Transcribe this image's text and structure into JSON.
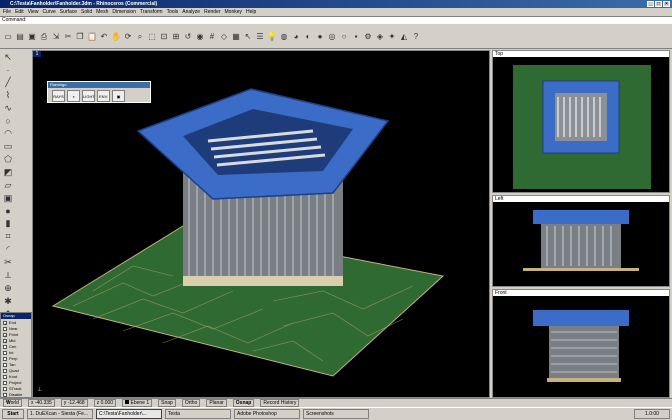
{
  "window": {
    "title": "C:\\Testa\\Fanholder\\Fanholder.3dm - Rhinoceros (Commercial)"
  },
  "menu": [
    "File",
    "Edit",
    "View",
    "Curve",
    "Surface",
    "Solid",
    "Mesh",
    "Dimension",
    "Transform",
    "Tools",
    "Analyze",
    "Render",
    "Monkey",
    "Help"
  ],
  "command": {
    "label": "Command"
  },
  "palette": {
    "title": "Flamingo",
    "buttons": [
      "RAYS RENDER",
      "",
      "LIGHT SET",
      "ENV. RUN",
      ""
    ]
  },
  "viewports": {
    "main_tag": "1",
    "top": "Top",
    "left": "Left",
    "front": "Front"
  },
  "osnap": {
    "title": "Osnap",
    "items": [
      {
        "label": "End",
        "on": true
      },
      {
        "label": "Near",
        "on": false
      },
      {
        "label": "Point",
        "on": true
      },
      {
        "label": "Mid",
        "on": true
      },
      {
        "label": "Cen",
        "on": false
      },
      {
        "label": "Int",
        "on": false
      },
      {
        "label": "Perp",
        "on": false
      },
      {
        "label": "Tan",
        "on": false
      },
      {
        "label": "Quad",
        "on": false
      },
      {
        "label": "Knot",
        "on": false
      },
      {
        "label": "Project",
        "on": false
      },
      {
        "label": "STrack",
        "on": false
      },
      {
        "label": "Disable",
        "on": false
      }
    ]
  },
  "status": {
    "cplane": "World",
    "x": "x -40.335",
    "y": "y -12.468",
    "z": "z 0.000",
    "layer": "Ebene 1",
    "snap": "Snap",
    "ortho": "Ortho",
    "planar": "Planar",
    "osnap": "Osnap",
    "record": "Record History"
  },
  "taskbar": {
    "start": "Start",
    "tasks": [
      "1. DuEXcan - Siesta (Fe...",
      "C:\\Testa\\Fanholder\\...",
      "Testa",
      "Adobe Photoshop",
      "Screenshots"
    ],
    "clock": "1.0:00"
  },
  "colors": {
    "accent": "#3a6ea5",
    "viewport_bg": "#000000",
    "holder_blue": "#3b6cc8",
    "pcb_green": "#2f6a32"
  }
}
